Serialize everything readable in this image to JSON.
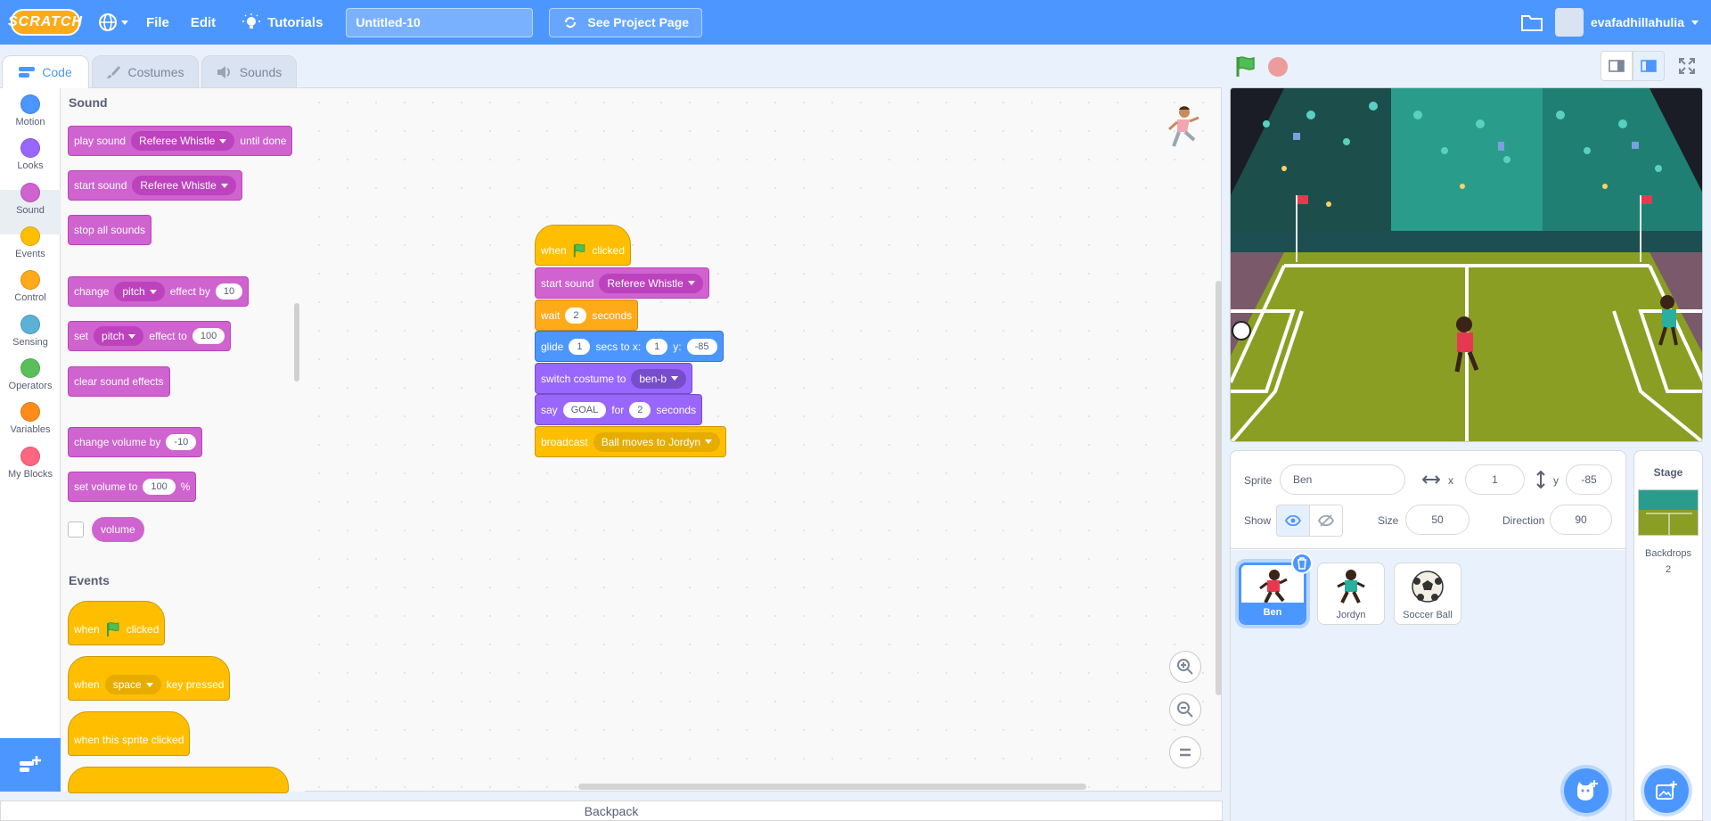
{
  "menu": {
    "logo": "SCRATCH",
    "file": "File",
    "edit": "Edit",
    "tutorials": "Tutorials",
    "project_title": "Untitled-10",
    "see_project": "See Project Page",
    "username": "evafadhillahulia"
  },
  "tabs": {
    "code": "Code",
    "costumes": "Costumes",
    "sounds": "Sounds"
  },
  "categories": [
    {
      "label": "Motion",
      "color": "#4c97ff"
    },
    {
      "label": "Looks",
      "color": "#9966ff"
    },
    {
      "label": "Sound",
      "color": "#cf63cf"
    },
    {
      "label": "Events",
      "color": "#ffbf00"
    },
    {
      "label": "Control",
      "color": "#ffab19"
    },
    {
      "label": "Sensing",
      "color": "#5cb1d6"
    },
    {
      "label": "Operators",
      "color": "#59c059"
    },
    {
      "label": "Variables",
      "color": "#ff8c1a"
    },
    {
      "label": "My Blocks",
      "color": "#ff6680"
    }
  ],
  "palette": {
    "sound_header": "Sound",
    "play_sound": "play sound",
    "play_sound_value": "Referee Whistle",
    "until_done": "until done",
    "start_sound": "start sound",
    "start_sound_value": "Referee Whistle",
    "stop_all_sounds": "stop all sounds",
    "change": "change",
    "pitch1": "pitch",
    "effect_by": "effect by",
    "effect_by_value": "10",
    "set": "set",
    "pitch2": "pitch",
    "effect_to": "effect to",
    "effect_to_value": "100",
    "clear_sound_effects": "clear sound effects",
    "change_volume_by": "change volume by",
    "change_volume_value": "-10",
    "set_volume_to": "set volume to",
    "set_volume_value": "100",
    "percent": "%",
    "volume": "volume",
    "events_header": "Events",
    "when": "when",
    "clicked": "clicked",
    "when2": "when",
    "space": "space",
    "key_pressed": "key pressed",
    "when_sprite_clicked": "when this sprite clicked"
  },
  "script": {
    "when": "when",
    "clicked": "clicked",
    "start_sound": "start sound",
    "sound_value": "Referee Whistle",
    "wait": "wait",
    "wait_value": "2",
    "seconds": "seconds",
    "glide": "glide",
    "glide_secs": "1",
    "secs_to_x": "secs to x:",
    "glide_x": "1",
    "y_label": "y:",
    "glide_y": "-85",
    "switch_costume": "switch costume to",
    "costume_value": "ben-b",
    "say": "say",
    "say_value": "GOAL",
    "for": "for",
    "say_secs": "2",
    "seconds2": "seconds",
    "broadcast": "broadcast",
    "broadcast_value": "Ball moves to Jordyn"
  },
  "backpack": "Backpack",
  "sprite_info": {
    "sprite_label": "Sprite",
    "sprite_name": "Ben",
    "x_label": "x",
    "x_value": "1",
    "y_label": "y",
    "y_value": "-85",
    "show_label": "Show",
    "size_label": "Size",
    "size_value": "50",
    "direction_label": "Direction",
    "direction_value": "90"
  },
  "sprites": [
    {
      "name": "Ben"
    },
    {
      "name": "Jordyn"
    },
    {
      "name": "Soccer Ball"
    }
  ],
  "stage_pane": {
    "label": "Stage",
    "backdrops_label": "Backdrops",
    "backdrops_count": "2"
  }
}
